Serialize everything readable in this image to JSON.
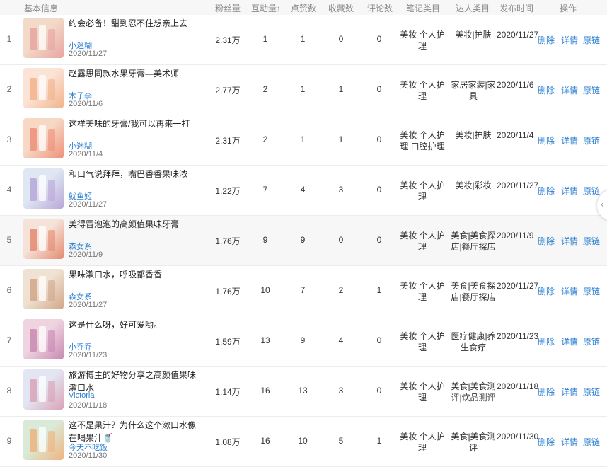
{
  "columns": {
    "basic": "基本信息",
    "fans": "粉丝量",
    "interactions": "互动量↑",
    "likes": "点赞数",
    "favorites": "收藏数",
    "comments": "评论数",
    "note_category": "笔记类目",
    "talent_category": "达人类目",
    "publish_time": "发布时间",
    "actions": "操作"
  },
  "actions": {
    "delete": "删除",
    "detail": "详情",
    "link": "原链"
  },
  "rows": [
    {
      "index": "1",
      "title": "约会必备！甜到忍不住想亲上去",
      "author": "小迷糊",
      "date": "2020/11/27",
      "fans": "2.31万",
      "interactions": "1",
      "likes": "1",
      "favorites": "0",
      "comments": "0",
      "note_category": "美妆 个人护理",
      "talent_category": "美妆|护肤",
      "publish_time": "2020/11/27"
    },
    {
      "index": "2",
      "title": "赵露思同款水果牙膏—美术师",
      "author": "木子李",
      "date": "2020/11/6",
      "fans": "2.77万",
      "interactions": "2",
      "likes": "1",
      "favorites": "1",
      "comments": "0",
      "note_category": "美妆 个人护理",
      "talent_category": "家居家装|家具",
      "publish_time": "2020/11/6"
    },
    {
      "index": "3",
      "title": "这样美味的牙膏/我可以再来一打",
      "author": "小迷糊",
      "date": "2020/11/4",
      "fans": "2.31万",
      "interactions": "2",
      "likes": "1",
      "favorites": "1",
      "comments": "0",
      "note_category": "美妆 个人护理 口腔护理",
      "talent_category": "美妆|护肤",
      "publish_time": "2020/11/4"
    },
    {
      "index": "4",
      "title": "和口气说拜拜，嘴巴香香果味浓",
      "author": "鱿鱼姬",
      "date": "2020/11/27",
      "fans": "1.22万",
      "interactions": "7",
      "likes": "4",
      "favorites": "3",
      "comments": "0",
      "note_category": "美妆 个人护理",
      "talent_category": "美妆|彩妆",
      "publish_time": "2020/11/27"
    },
    {
      "index": "5",
      "title": "美得冒泡泡的高颜值果味牙膏",
      "author": "森女系",
      "date": "2020/11/9",
      "fans": "1.76万",
      "interactions": "9",
      "likes": "9",
      "favorites": "0",
      "comments": "0",
      "note_category": "美妆 个人护理",
      "talent_category": "美食|美食探店|餐厅探店",
      "publish_time": "2020/11/9"
    },
    {
      "index": "6",
      "title": "果味漱口水，呼吸都香香",
      "author": "森女系",
      "date": "2020/11/27",
      "fans": "1.76万",
      "interactions": "10",
      "likes": "7",
      "favorites": "2",
      "comments": "1",
      "note_category": "美妆 个人护理",
      "talent_category": "美食|美食探店|餐厅探店",
      "publish_time": "2020/11/27"
    },
    {
      "index": "7",
      "title": "这是什么呀，好可爱哟。",
      "author": "小乔乔",
      "date": "2020/11/23",
      "fans": "1.59万",
      "interactions": "13",
      "likes": "9",
      "favorites": "4",
      "comments": "0",
      "note_category": "美妆 个人护理",
      "talent_category": "医疗健康|养生食疗",
      "publish_time": "2020/11/23"
    },
    {
      "index": "8",
      "title": "旅游博主的好物分享之高颜值果味漱口水",
      "author": "Victoria",
      "date": "2020/11/18",
      "fans": "1.14万",
      "interactions": "16",
      "likes": "13",
      "favorites": "3",
      "comments": "0",
      "note_category": "美妆 个人护理",
      "talent_category": "美食|美食测评|饮品测评",
      "publish_time": "2020/11/18"
    },
    {
      "index": "9",
      "title": "这不是果汁？为什么这个漱口水像在喝果汁🥤",
      "author": "今天不吃饭",
      "date": "2020/11/30",
      "fans": "1.08万",
      "interactions": "16",
      "likes": "10",
      "favorites": "5",
      "comments": "1",
      "note_category": "美妆 个人护理",
      "talent_category": "美食|美食测评",
      "publish_time": "2020/11/30"
    }
  ],
  "thumb_colors": [
    [
      "#f3d9c8",
      "#e8a4a0"
    ],
    [
      "#fbe3d6",
      "#f1b38a"
    ],
    [
      "#f6d8c4",
      "#ef8f7a"
    ],
    [
      "#dfe7f3",
      "#b9a6d8"
    ],
    [
      "#f5e2d8",
      "#e48a70"
    ],
    [
      "#efe2d2",
      "#d2a68a"
    ],
    [
      "#efd3df",
      "#c889b3"
    ],
    [
      "#e3e6f2",
      "#d9a2b6"
    ],
    [
      "#d9ead8",
      "#f0b37e"
    ]
  ]
}
